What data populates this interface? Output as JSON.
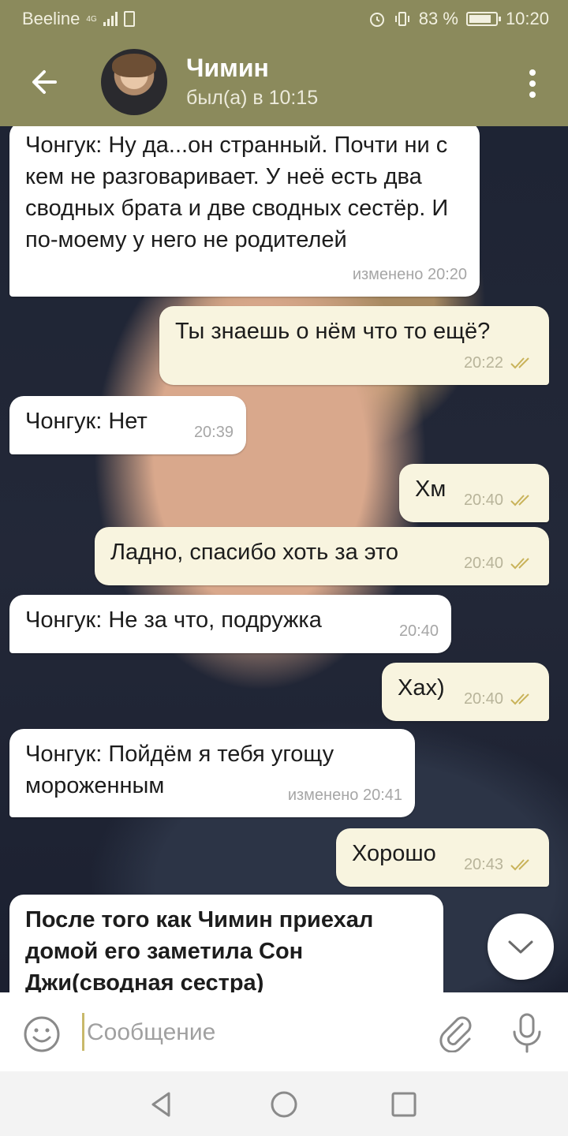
{
  "status_bar": {
    "carrier": "Beeline",
    "network": "4G",
    "battery": "83 %",
    "battery_level": 0.83,
    "time": "10:20"
  },
  "header": {
    "contact_name": "Чимин",
    "last_seen": "был(а) в 10:15"
  },
  "messages": [
    {
      "dir": "in",
      "text": "Чонгук: Ну да...он странный. Почти ни с кем не разговаривает. У неё есть два сводных брата и две сводных сестёр. И по-моему у него не родителей",
      "meta": "изменено 20:20"
    },
    {
      "dir": "out",
      "text": "Ты знаешь о нём что то ещё?",
      "meta": "20:22",
      "read": true
    },
    {
      "dir": "in",
      "text": "Чонгук: Нет",
      "meta": "20:39"
    },
    {
      "dir": "out",
      "text": "Хм",
      "meta": "20:40",
      "read": true
    },
    {
      "dir": "out",
      "text": "Ладно, спасибо хоть за это",
      "meta": "20:40",
      "read": true
    },
    {
      "dir": "in",
      "text": "Чонгук: Не за что, подружка",
      "meta": "20:40"
    },
    {
      "dir": "out",
      "text": "Хах)",
      "meta": "20:40",
      "read": true
    },
    {
      "dir": "in",
      "text": "Чонгук: Пойдём я тебя угощу мороженным",
      "meta": "изменено 20:41"
    },
    {
      "dir": "out",
      "text": "Хорошо",
      "meta": "20:43",
      "read": true
    },
    {
      "dir": "in",
      "text": "После того как Чимин приехал домой его заметила Сон Джи(сводная сестра)",
      "meta": "",
      "bold": true
    }
  ],
  "composer": {
    "placeholder": "Сообщение"
  },
  "icons": {
    "back": "arrow-left-icon",
    "menu": "more-vert-icon",
    "emoji": "smiley-icon",
    "attach": "paperclip-icon",
    "mic": "microphone-icon",
    "scroll": "chevron-down-icon",
    "nav_back": "triangle-back-icon",
    "nav_home": "circle-home-icon",
    "nav_recent": "square-recents-icon"
  },
  "colors": {
    "header_bg": "#8b8a5c",
    "incoming_bubble": "#ffffff",
    "outgoing_bubble": "#f8f4df",
    "read_ticks": "#c9b35a"
  }
}
